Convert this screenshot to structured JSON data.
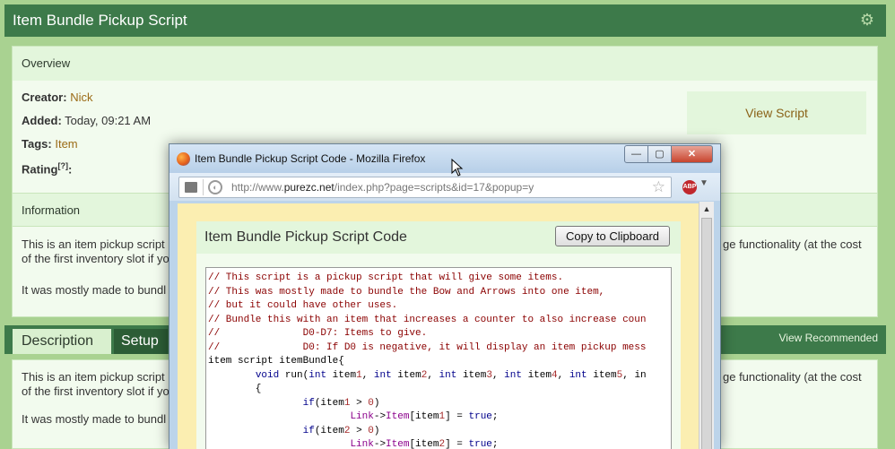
{
  "header": {
    "title": "Item Bundle Pickup Script"
  },
  "overview": {
    "heading": "Overview",
    "creator_label": "Creator:",
    "creator_value": "Nick",
    "added_label": "Added:",
    "added_value": "Today, 09:21 AM",
    "tags_label": "Tags:",
    "tags_value": "Item",
    "rating_label": "Rating",
    "rating_sup": "[?]",
    "rating_colon": ":",
    "view_script": "View Script"
  },
  "information": {
    "heading": "Information",
    "line1_left": "This is an item pickup script",
    "line1_right": "ge functionality (at the cost",
    "line2_left": "of the first inventory slot if yo",
    "line3_left": "It was mostly made to bundl"
  },
  "tabs": {
    "description": "Description",
    "setup": "Setup",
    "view_recommended": "View Recommended"
  },
  "description": {
    "line1_left": "This is an item pickup script",
    "line1_right": "ge functionality (at the cost",
    "line2_left": "of the first inventory slot if yo",
    "line3_left": "It was mostly made to bundl"
  },
  "popup": {
    "window_title": "Item Bundle Pickup Script Code - Mozilla Firefox",
    "url_prefix": "http://www.",
    "url_domain": "purezc.net",
    "url_path": "/index.php?page=scripts&id=17&popup=y",
    "min_label": "—",
    "max_label": "▢",
    "close_label": "✕",
    "abp_label": "ABP",
    "panel_title": "Item Bundle Pickup Script Code",
    "copy_button": "Copy to Clipboard",
    "code_lines": [
      "// This script is a pickup script that will give some items.",
      "// This was mostly made to bundle the Bow and Arrows into one item,",
      "// but it could have other uses.",
      "// Bundle this with an item that increases a counter to also increase coun",
      "//              D0-D7: Items to give.",
      "//              D0: If D0 is negative, it will display an item pickup mess",
      "item script itemBundle{",
      "        void run(int item1, int item2, int item3, int item4, int item5, in",
      "        {",
      "                if(item1 > 0)",
      "                        Link->Item[item1] = true;",
      "                if(item2 > 0)",
      "                        Link->Item[item2] = true;"
    ]
  },
  "colors": {
    "page_bg": "#a9d291",
    "header_bg": "#3d7a4a",
    "panel_bg": "#f2fbee",
    "link": "#9b6b16",
    "code_comment": "#8b0000",
    "code_keyword": "#00008b"
  },
  "icons": {
    "settings": "gear-icon",
    "firefox": "firefox-logo-icon",
    "page": "page-icon",
    "globe": "globe-icon",
    "bookmark": "star-icon",
    "adblock": "adblock-icon",
    "cursor": "mouse-cursor-icon"
  }
}
